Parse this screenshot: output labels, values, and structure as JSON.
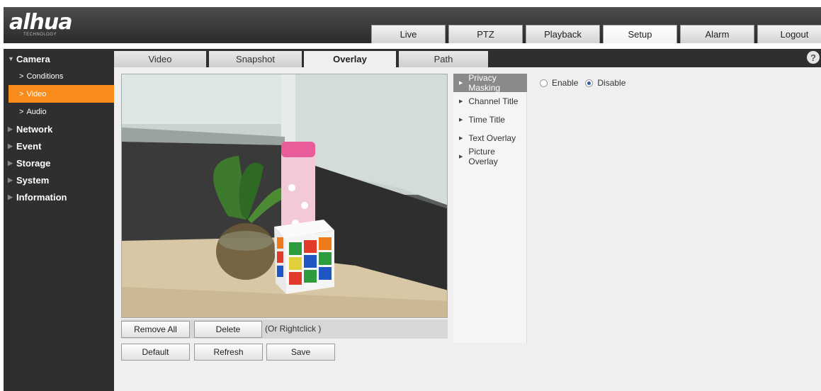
{
  "header": {
    "logo_text": "alhua",
    "logo_sub": "TECHNOLOGY",
    "nav": [
      {
        "label": "Live",
        "active": false
      },
      {
        "label": "PTZ",
        "active": false
      },
      {
        "label": "Playback",
        "active": false
      },
      {
        "label": "Setup",
        "active": true
      },
      {
        "label": "Alarm",
        "active": false
      },
      {
        "label": "Logout",
        "active": false
      }
    ]
  },
  "sidebar": {
    "camera": "Camera",
    "camera_children": [
      {
        "label": "Conditions",
        "active": false
      },
      {
        "label": "Video",
        "active": true
      },
      {
        "label": "Audio",
        "active": false
      }
    ],
    "sections": [
      "Network",
      "Event",
      "Storage",
      "System",
      "Information"
    ]
  },
  "tabs": [
    {
      "label": "Video",
      "active": false
    },
    {
      "label": "Snapshot",
      "active": false
    },
    {
      "label": "Overlay",
      "active": true
    },
    {
      "label": "Path",
      "active": false
    }
  ],
  "help_icon": "?",
  "video_toolbar": {
    "remove_all": "Remove All",
    "delete": "Delete",
    "hint": "(Or Rightclick )"
  },
  "actions": {
    "default": "Default",
    "refresh": "Refresh",
    "save": "Save"
  },
  "overlay_menu": [
    {
      "label": "Privacy Masking",
      "active": true
    },
    {
      "label": "Channel Title",
      "active": false
    },
    {
      "label": "Time Title",
      "active": false
    },
    {
      "label": "Text Overlay",
      "active": false
    },
    {
      "label": "Picture Overlay",
      "active": false
    }
  ],
  "privacy_masking": {
    "enable_label": "Enable",
    "disable_label": "Disable",
    "selected": "Disable"
  },
  "colors": {
    "sidebar_bg": "#2f2f2f",
    "accent": "#f98b1a",
    "content_bg": "#efefef"
  }
}
